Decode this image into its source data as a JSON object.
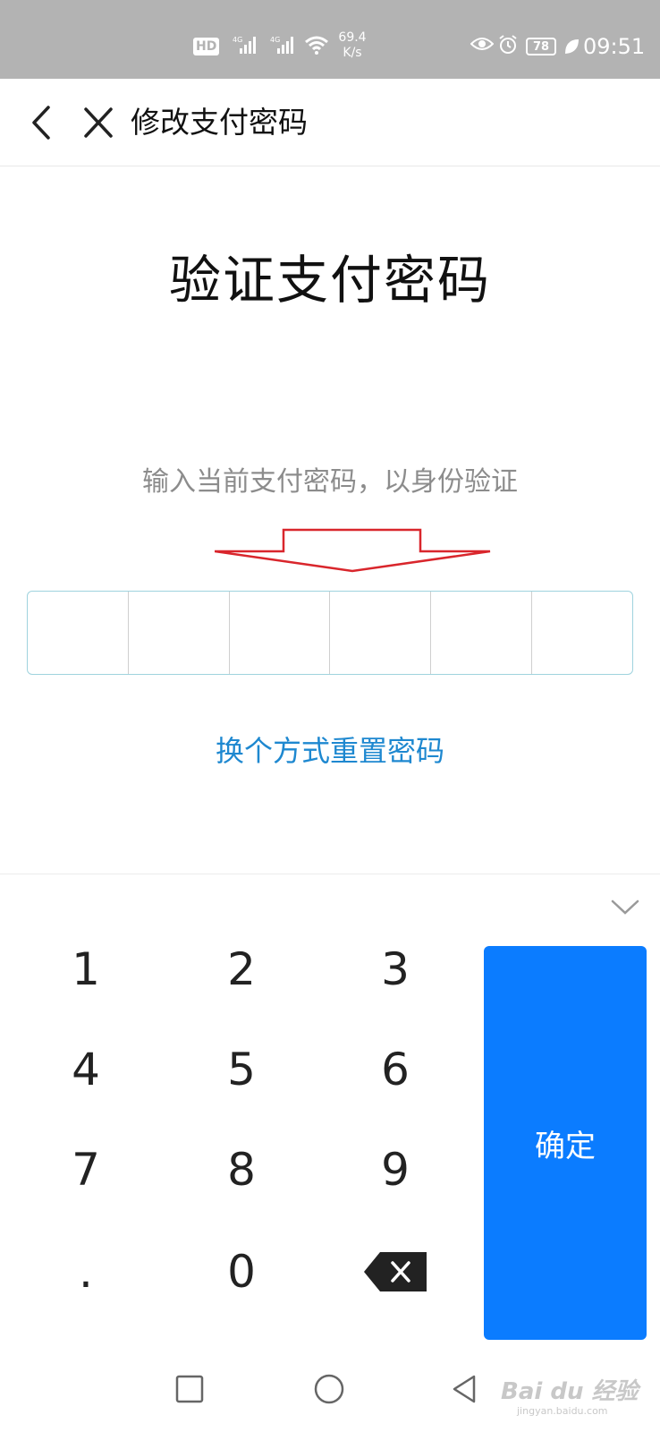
{
  "status_bar": {
    "hd": "HD",
    "net1": "4G",
    "net2": "4G",
    "speed_value": "69.4",
    "speed_unit": "K/s",
    "battery": "78",
    "time": "09:51"
  },
  "header": {
    "title": "修改支付密码",
    "back_icon": "chevron-left-icon",
    "close_icon": "close-icon"
  },
  "main": {
    "title": "验证支付密码",
    "hint": "输入当前支付密码，以身份验证",
    "pin_length": 6,
    "reset_link": "换个方式重置密码"
  },
  "keypad": {
    "keys": [
      "1",
      "2",
      "3",
      "4",
      "5",
      "6",
      "7",
      "8",
      "9",
      ".",
      "0"
    ],
    "confirm_label": "确定",
    "delete_icon": "backspace-icon",
    "collapse_icon": "chevron-down-icon"
  },
  "watermark": {
    "brand": "Bai du 经验",
    "url": "jingyan.baidu.com"
  },
  "colors": {
    "accent": "#0b7cff",
    "link": "#1e88d0",
    "arrow": "#d9262c",
    "status_bg": "#b3b3b3"
  }
}
